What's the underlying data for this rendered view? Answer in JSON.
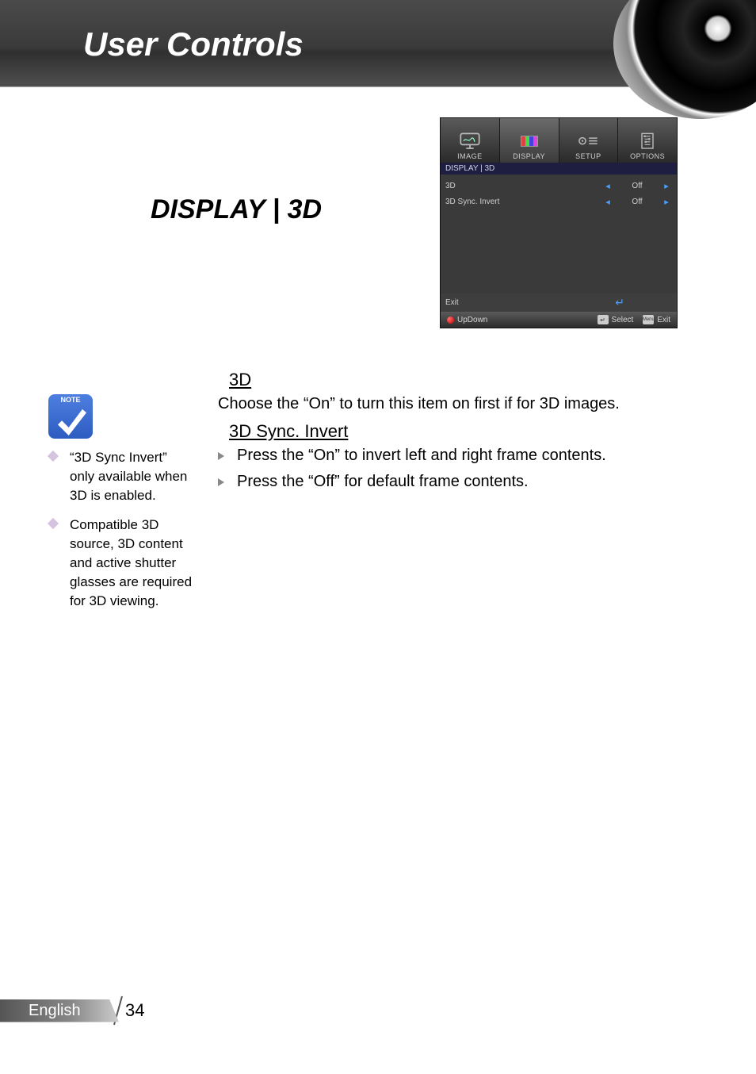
{
  "header": {
    "title": "User Controls"
  },
  "section": {
    "title": "DISPLAY | 3D"
  },
  "osd": {
    "tabs": [
      "IMAGE",
      "DISPLAY",
      "SETUP",
      "OPTIONS"
    ],
    "active_tab_index": 1,
    "breadcrumb": "DISPLAY  |  3D",
    "rows": [
      {
        "label": "3D",
        "value": "Off"
      },
      {
        "label": "3D Sync. Invert",
        "value": "Off"
      }
    ],
    "exit_label": "Exit",
    "footer": {
      "updown": "UpDown",
      "select": "Select",
      "exit": "Exit",
      "menu_key": "Menu"
    }
  },
  "content": {
    "h1": "3D",
    "p1": "Choose the “On” to turn this item on first if for 3D images.",
    "h2": "3D Sync. Invert",
    "li1": "Press the “On” to invert left and right frame contents.",
    "li2": "Press the “Off” for default frame contents."
  },
  "note": {
    "badge": "NOTE",
    "items": [
      "“3D Sync Invert” only available when 3D is enabled.",
      "Compatible 3D source, 3D content and active shutter glasses are required for 3D viewing."
    ]
  },
  "footer": {
    "language": "English",
    "page": "34"
  }
}
